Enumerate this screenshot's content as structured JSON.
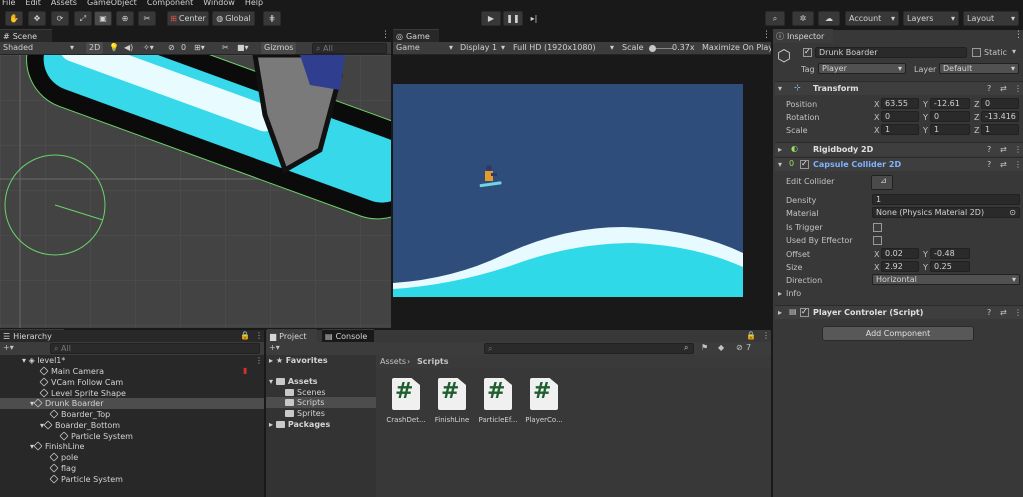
{
  "menu": [
    "File",
    "Edit",
    "Assets",
    "GameObject",
    "Component",
    "Window",
    "Help"
  ],
  "toolbar": {
    "center": "Center",
    "global": "Global",
    "account": "Account",
    "layers": "Layers",
    "layout": "Layout"
  },
  "scene": {
    "tab": "Scene",
    "shading": "Shaded",
    "mode2d": "2D",
    "gizmos": "Gizmos",
    "gizmo_count": "0",
    "search_placeholder": "All"
  },
  "game": {
    "tab": "Game",
    "view": "Game",
    "display": "Display 1",
    "resolution": "Full HD (1920x1080)",
    "scale_label": "Scale",
    "scale_value": "0.37x",
    "maximize": "Maximize On Play"
  },
  "inspector": {
    "tab": "Inspector",
    "object_name": "Drunk Boarder",
    "static_label": "Static",
    "tag_label": "Tag",
    "tag": "Player",
    "layer_label": "Layer",
    "layer": "Default",
    "transform": {
      "title": "Transform",
      "rows": [
        {
          "label": "Position",
          "x": "63.55",
          "y": "-12.61",
          "z": "0"
        },
        {
          "label": "Rotation",
          "x": "0",
          "y": "0",
          "z": "-13.416"
        },
        {
          "label": "Scale",
          "x": "1",
          "y": "1",
          "z": "1"
        }
      ]
    },
    "rigidbody": {
      "title": "Rigidbody 2D"
    },
    "capsule": {
      "title": "Capsule Collider 2D",
      "edit_collider": "Edit Collider",
      "density_label": "Density",
      "density": "1",
      "material_label": "Material",
      "material": "None (Physics Material 2D)",
      "is_trigger": "Is Trigger",
      "used_by_effector": "Used By Effector",
      "offset_label": "Offset",
      "offset_x": "0.02",
      "offset_y": "-0.48",
      "size_label": "Size",
      "size_x": "2.92",
      "size_y": "0.25",
      "direction_label": "Direction",
      "direction": "Horizontal",
      "info": "Info"
    },
    "script": {
      "title": "Player Controler (Script)"
    },
    "add_component": "Add Component"
  },
  "hierarchy": {
    "tab": "Hierarchy",
    "search_placeholder": "All",
    "items": [
      "level1*",
      "Main Camera",
      "VCam Follow Cam",
      "Level Sprite Shape",
      "Drunk Boarder",
      "Boarder_Top",
      "Boarder_Bottom",
      "Particle System",
      "FinishLine",
      "pole",
      "flag",
      "Particle System"
    ]
  },
  "project": {
    "tab": "Project",
    "console_tab": "Console",
    "favorites": "Favorites",
    "assets": "Assets",
    "folders": [
      "Scenes",
      "Scripts",
      "Sprites"
    ],
    "packages": "Packages",
    "breadcrumb_root": "Assets",
    "breadcrumb_sep": "›",
    "breadcrumb_current": "Scripts",
    "count": "7",
    "files": [
      "CrashDet...",
      "FinishLine",
      "ParticleEf...",
      "PlayerCo..."
    ]
  },
  "colors": {
    "sky": "#2f4d7a",
    "snow": "#2fd9e8",
    "accent": "#3a72c4"
  }
}
